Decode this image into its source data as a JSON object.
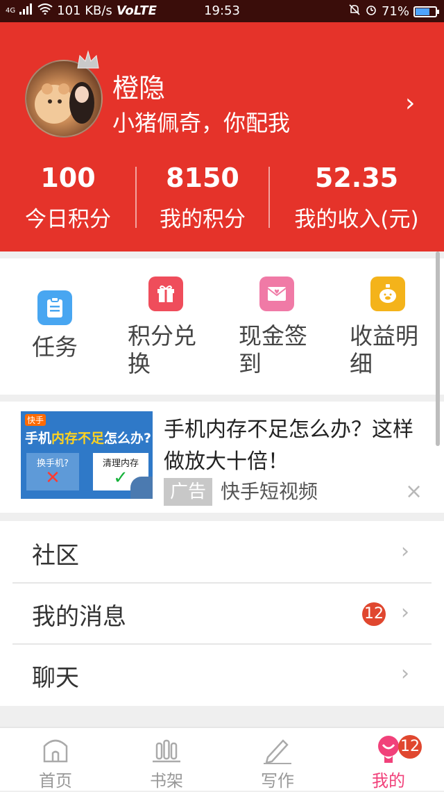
{
  "status_bar": {
    "network_type": "4G",
    "speed": "101 KB/s",
    "volte": "VoLTE",
    "time": "19:53",
    "battery_percent": "71%",
    "battery_level": 0.71
  },
  "profile": {
    "name": "橙隐",
    "signature": "小猪佩奇，你配我",
    "chevron": "›"
  },
  "stats": [
    {
      "value": "100",
      "label": "今日积分"
    },
    {
      "value": "8150",
      "label": "我的积分"
    },
    {
      "value": "52.35",
      "label": "我的收入(元)"
    }
  ],
  "quick_actions": [
    {
      "label_line1": "任务",
      "label_line2": "",
      "icon": "clipboard-icon",
      "color": "#48a6f1"
    },
    {
      "label_line1": "积分兑",
      "label_line2": "换",
      "icon": "gift-icon",
      "color": "#ef4d5b"
    },
    {
      "label_line1": "现金签",
      "label_line2": "到",
      "icon": "envelope-heart-icon",
      "color": "#f07aa6"
    },
    {
      "label_line1": "收益明",
      "label_line2": "细",
      "icon": "piggy-bank-icon",
      "color": "#f4b31a"
    }
  ],
  "ad": {
    "image_brand": "快手",
    "image_headline_a": "手机",
    "image_headline_b": "内存不足",
    "image_headline_c": "怎么办?",
    "image_option1": "换手机?",
    "image_option2": "清理内存",
    "title": "手机内存不足怎么办？这样做放大十倍！",
    "tag": "广告",
    "source": "快手短视频",
    "close": "×"
  },
  "menu": [
    {
      "label": "社区",
      "badge": ""
    },
    {
      "label": "我的消息",
      "badge": "12"
    },
    {
      "label": "聊天",
      "badge": ""
    }
  ],
  "tabs": [
    {
      "label": "首页",
      "active": false,
      "icon": "home-icon"
    },
    {
      "label": "书架",
      "active": false,
      "icon": "bookshelf-icon"
    },
    {
      "label": "写作",
      "active": false,
      "icon": "pen-icon"
    },
    {
      "label": "我的",
      "active": true,
      "icon": "profile-icon",
      "badge": "12"
    }
  ],
  "colors": {
    "header_red": "#e5332a",
    "active_pink": "#f1417a",
    "badge_red": "#e0472f"
  }
}
